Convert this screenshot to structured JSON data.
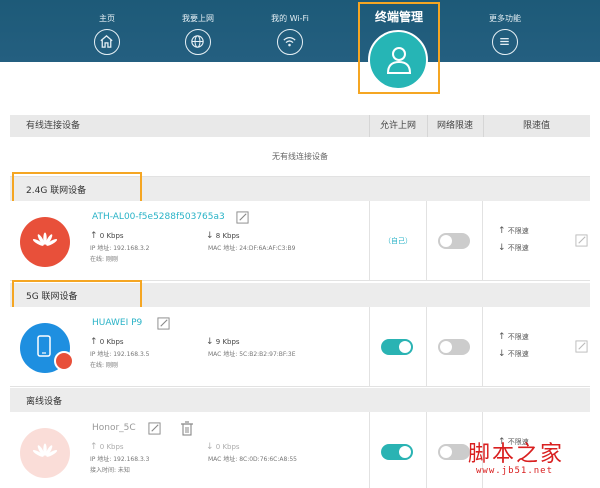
{
  "nav": {
    "items": [
      {
        "label": "主页",
        "icon": "home-icon"
      },
      {
        "label": "我要上网",
        "icon": "globe-icon"
      },
      {
        "label": "我的 Wi-Fi",
        "icon": "wifi-icon"
      },
      {
        "label": "终端管理",
        "icon": "user-icon",
        "active": true
      },
      {
        "label": "更多功能",
        "icon": "menu-icon"
      }
    ]
  },
  "table": {
    "headers": {
      "wired": "有线连接设备",
      "allow": "允许上网",
      "net_limit": "网络限速",
      "limit_value": "限速值"
    },
    "empty_wired": "无有线连接设备"
  },
  "sections": {
    "g24": "2.4G 联网设备",
    "g5": "5G 联网设备",
    "offline": "离线设备"
  },
  "devices": [
    {
      "name": "ATH-AL00-f5e5288f503765a3",
      "up": "0 Kbps",
      "down": "8 Kbps",
      "ip": "IP 地址: 192.168.3.2",
      "mac": "MAC 地址: 24:DF:6A:AF:C3:B9",
      "status": "在线: 刚刚",
      "allow": "（自己）",
      "limit_up": "不限速",
      "limit_down": "不限速"
    },
    {
      "name": "HUAWEI P9",
      "up": "0 Kbps",
      "down": "9 Kbps",
      "ip": "IP 地址: 192.168.3.5",
      "mac": "MAC 地址: 5C:B2:B2:97:BF:3E",
      "status": "在线: 刚刚",
      "limit_up": "不限速",
      "limit_down": "不限速"
    },
    {
      "name": "Honor_5C",
      "up": "0 Kbps",
      "down": "0 Kbps",
      "ip": "IP 地址: 192.168.3.3",
      "mac": "MAC 地址: 8C:0D:76:6C:A8:55",
      "status": "接入时间: 未知",
      "limit_up": "不限速"
    }
  ],
  "watermark": {
    "cn": "脚本之家",
    "url": "www.jb51.net"
  },
  "colors": {
    "header": "#1d5a78",
    "accent": "#2ab3c7",
    "highlight": "#f5a623",
    "toggle_on": "#2ab3b3",
    "huawei_red": "#e8503a"
  }
}
